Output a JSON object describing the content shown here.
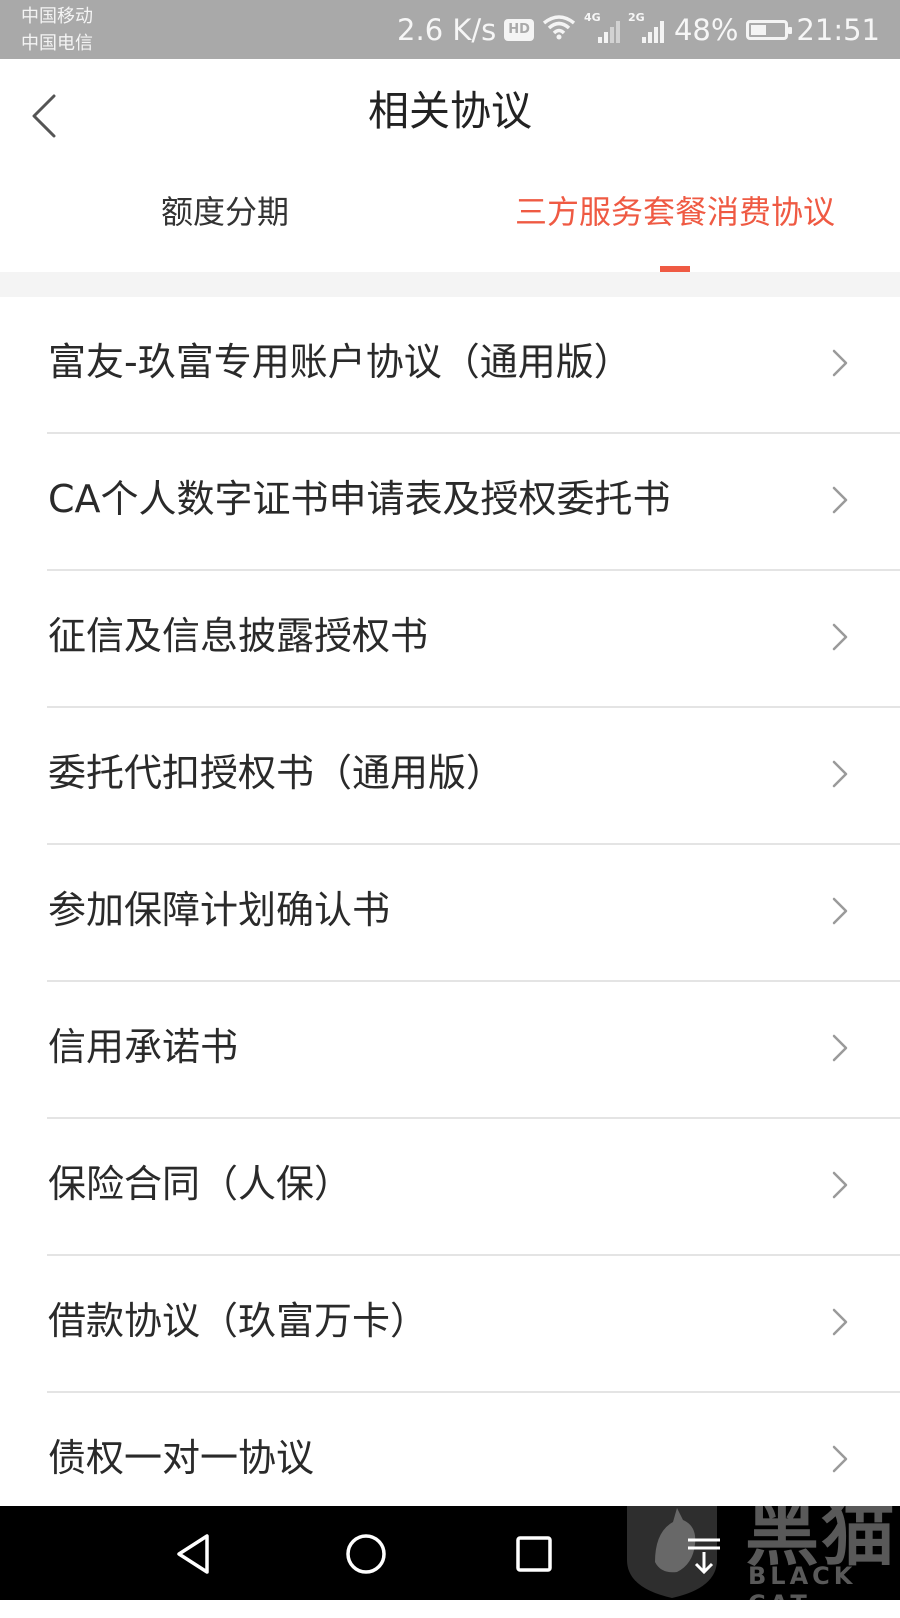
{
  "status_bar": {
    "carrier_1": "中国移动",
    "carrier_2": "中国电信",
    "net_speed": "2.6 K/s",
    "hd_badge": "HD",
    "net_4g": "4G",
    "net_2g": "2G",
    "battery_level": "48%",
    "time": "21:51"
  },
  "header": {
    "title": "相关协议"
  },
  "tabs": [
    {
      "label": "额度分期",
      "active": false
    },
    {
      "label": "三方服务套餐消费协议",
      "active": true
    }
  ],
  "agreements": [
    "富友-玖富专用账户协议（通用版）",
    "CA个人数字证书申请表及授权委托书",
    "征信及信息披露授权书",
    "委托代扣授权书（通用版）",
    "参加保障计划确认书",
    "信用承诺书",
    "保险合同（人保）",
    "借款协议（玖富万卡）",
    "债权一对一协议"
  ],
  "watermark": {
    "title": "黑猫",
    "subtitle": "BLACK CAT"
  },
  "colors": {
    "accent": "#ef5a43",
    "status_bar": "#a9a9a9",
    "text_primary": "#2a2a2a",
    "divider": "#e4e4e4",
    "nav_bar": "#000000"
  },
  "icons": {
    "back": "chevron-left-icon",
    "row": "chevron-right-icon",
    "nav_back": "triangle-back-icon",
    "nav_home": "circle-home-icon",
    "nav_recent": "square-recent-icon",
    "nav_pull": "pull-down-icon"
  }
}
